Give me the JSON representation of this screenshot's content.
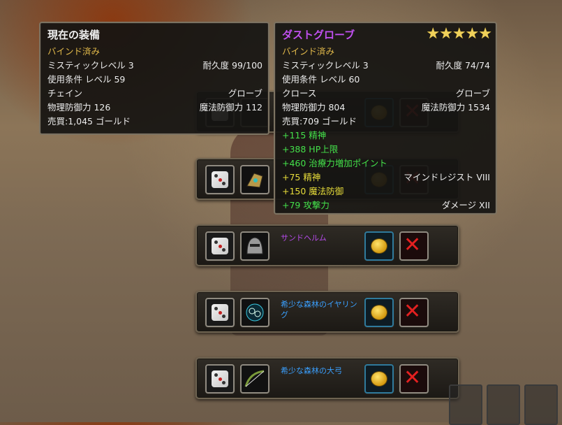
{
  "current_equipment": {
    "title": "現在の装備",
    "bind": "バインド済み",
    "mystic": "ミスティックレベル 3",
    "durability": "耐久度 99/100",
    "requirement": "使用条件 レベル 59",
    "material": "チェイン",
    "type": "グローブ",
    "pdef": "物理防御力 126",
    "mdef": "魔法防御力 112",
    "sell": "売買:1,045 ゴールド"
  },
  "item_tooltip": {
    "title": "ダストグローブ",
    "stars": "★★★★★",
    "bind": "バインド済み",
    "mystic": "ミスティックレベル 3",
    "durability": "耐久度 74/74",
    "requirement": "使用条件 レベル 60",
    "material": "クロース",
    "type": "グローブ",
    "pdef": "物理防御力 804",
    "mdef": "魔法防御力 1534",
    "sell": "売買:709 ゴールド",
    "bonus1": "+115 精神",
    "bonus2": "+388 HP上限",
    "bonus3": "+460 治療力増加ポイント",
    "bonus4": "+75 精神",
    "bonus4_right": "マインドレジスト VIII",
    "bonus5": "+150 魔法防御",
    "bonus6": "+79 攻撃力",
    "bonus6_right": "ダメージ XII"
  },
  "loot_rows": [
    {
      "name": ""
    },
    {
      "name": ""
    },
    {
      "name": "サンドヘルム"
    },
    {
      "name": "希少な森林のイヤリング"
    },
    {
      "name": "希少な森林の大弓"
    }
  ],
  "colors": {
    "rare": "#3aa0ff",
    "epic": "#b44ae8",
    "bind_gold": "#e0b84a",
    "bonus_green": "#44e04a",
    "bonus_yellow": "#e7dc3a"
  }
}
